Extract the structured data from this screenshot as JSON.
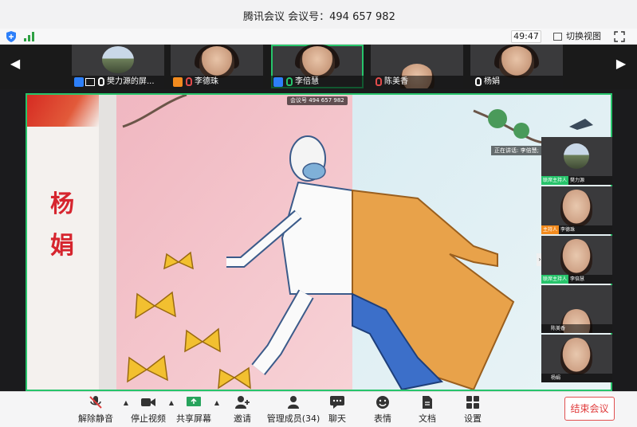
{
  "window": {
    "title": "腾讯会议 会议号：494 657 982"
  },
  "status": {
    "timer": "49:47",
    "switch_view": "切换视图"
  },
  "strip": {
    "participants": [
      {
        "name": "樊力源的屏...",
        "role": "host"
      },
      {
        "name": "李德珠"
      },
      {
        "name": "李倍慧"
      },
      {
        "name": "陈美香"
      },
      {
        "name": "杨娟"
      }
    ]
  },
  "share": {
    "meeting_tag": "会议号 494 657 982",
    "speaking": "正在讲话: 李倍慧;",
    "artist_name": "杨娟"
  },
  "side": {
    "tiles": [
      {
        "badge": "联席主持人",
        "name": "樊力源"
      },
      {
        "badge": "主持人",
        "name": "李德珠"
      },
      {
        "badge": "联席主持人",
        "name": "李倍慧"
      },
      {
        "name": "陈美香"
      },
      {
        "name": "杨娟"
      }
    ]
  },
  "toolbar": {
    "unmute": "解除静音",
    "stop_video": "停止视频",
    "share_screen": "共享屏幕",
    "invite": "邀请",
    "members": "管理成员(34)",
    "chat": "聊天",
    "emoji": "表情",
    "docs": "文档",
    "settings": "设置",
    "end": "结束会议"
  },
  "colors": {
    "active_green": "#27c46b",
    "end_red": "#e03c3c",
    "host_blue": "#2d7ff9"
  }
}
